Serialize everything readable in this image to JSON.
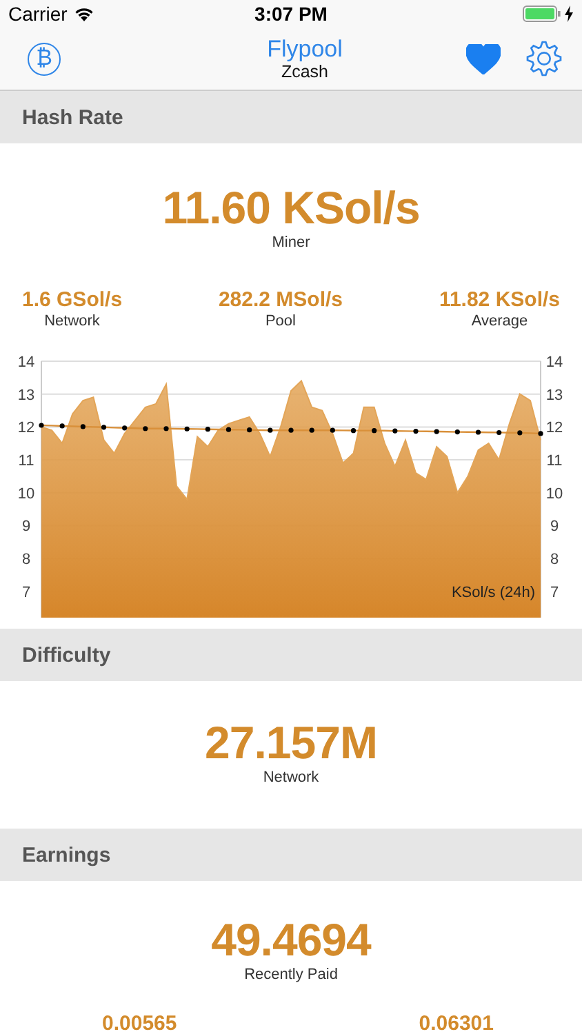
{
  "status_bar": {
    "carrier": "Carrier",
    "time": "3:07 PM"
  },
  "nav": {
    "left_icon": "₿",
    "title": "Flypool",
    "subtitle": "Zcash",
    "favorite": true
  },
  "sections": [
    {
      "kind": "hashrate",
      "title": "Hash Rate",
      "main": {
        "value": "11.60 KSol/s",
        "label": "Miner"
      },
      "stats": [
        {
          "value": "1.6 GSol/s",
          "label": "Network"
        },
        {
          "value": "282.2 MSol/s",
          "label": "Pool"
        },
        {
          "value": "11.82 KSol/s",
          "label": "Average"
        }
      ],
      "chart_data": {
        "type": "area",
        "grid": true,
        "ylabel": "KSol/s (24h)",
        "ylim": [
          6.2,
          14
        ],
        "yticks": [
          7,
          8,
          9,
          10,
          11,
          12,
          13,
          14
        ],
        "annotations": [
          "14",
          "13",
          "12",
          "11",
          "10",
          "9",
          "8",
          "7"
        ],
        "series": [
          {
            "color": "#e3a558",
            "values": [
              12.0,
              11.9,
              11.5,
              12.4,
              12.8,
              12.9,
              11.6,
              11.2,
              11.8,
              12.2,
              12.6,
              12.7,
              13.3,
              10.2,
              9.8,
              11.7,
              11.4,
              11.9,
              12.1,
              12.2,
              12.3,
              11.8,
              11.1,
              12.0,
              13.1,
              13.4,
              12.6,
              12.5,
              11.8,
              10.9,
              11.2,
              12.6,
              12.6,
              11.5,
              10.8,
              11.6,
              10.6,
              10.4,
              11.4,
              11.1,
              10.0,
              10.5,
              11.3,
              11.5,
              11.0,
              12.1,
              13.0,
              12.8,
              11.6
            ]
          },
          {
            "type": "line",
            "color": "#d9903a",
            "values": [
              12.05,
              12.04,
              12.03,
              12.02,
              12.01,
              12.0,
              11.99,
              11.98,
              11.97,
              11.96,
              11.95,
              11.95,
              11.95,
              11.945,
              11.94,
              11.935,
              11.93,
              11.925,
              11.92,
              11.915,
              11.91,
              11.905,
              11.9,
              11.9,
              11.9,
              11.9,
              11.9,
              11.9,
              11.9,
              11.895,
              11.89,
              11.89,
              11.89,
              11.885,
              11.88,
              11.875,
              11.87,
              11.865,
              11.86,
              11.855,
              11.85,
              11.845,
              11.84,
              11.835,
              11.83,
              11.825,
              11.82,
              11.81,
              11.8
            ]
          },
          {
            "type": "scatter",
            "color": "#000000",
            "values": [
              12.05,
              null,
              12.03,
              null,
              12.01,
              null,
              11.99,
              null,
              11.97,
              null,
              11.95,
              null,
              11.95,
              null,
              11.94,
              null,
              11.93,
              null,
              11.92,
              null,
              11.91,
              null,
              11.9,
              null,
              11.9,
              null,
              11.9,
              null,
              11.9,
              null,
              11.89,
              null,
              11.89,
              null,
              11.88,
              null,
              11.87,
              null,
              11.86,
              null,
              11.85,
              null,
              11.84,
              null,
              11.83,
              null,
              11.82,
              null,
              11.8
            ]
          }
        ]
      }
    },
    {
      "kind": "difficulty",
      "title": "Difficulty",
      "main": {
        "value": "27.157M",
        "label": "Network"
      }
    },
    {
      "kind": "earnings",
      "title": "Earnings",
      "main": {
        "value": "49.4694",
        "label": "Recently Paid"
      },
      "stats": [
        {
          "value": "0.00565"
        },
        {
          "value": "0.06301"
        }
      ]
    }
  ]
}
